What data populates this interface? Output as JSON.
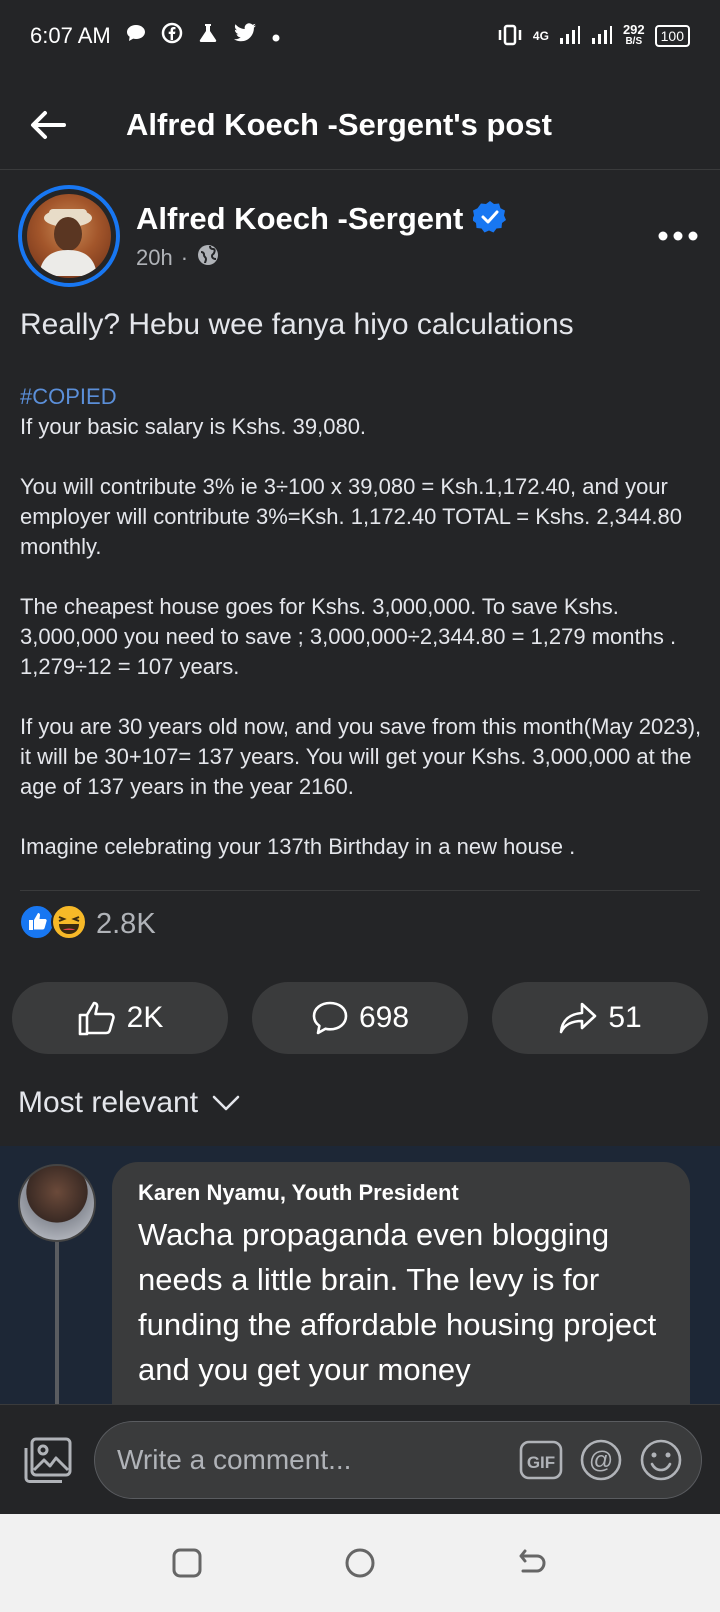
{
  "status_bar": {
    "time": "6:07 AM",
    "network": "4G",
    "speed_value": "292",
    "speed_unit": "B/S",
    "battery": "100"
  },
  "header": {
    "title": "Alfred Koech -Sergent's post"
  },
  "post": {
    "author": "Alfred Koech -Sergent",
    "time": "20h",
    "headline": "Really? Hebu wee fanya hiyo calculations",
    "hashtag": "#COPIED",
    "body": "If your basic salary is Kshs. 39,080.\n\nYou will contribute 3% ie 3÷100 x 39,080 = Ksh.1,172.40, and your employer will contribute 3%=Ksh. 1,172.40 TOTAL = Kshs. 2,344.80 monthly.\n\nThe cheapest house goes for Kshs. 3,000,000. To save Kshs. 3,000,000 you need to save ; 3,000,000÷2,344.80 = 1,279 months . 1,279÷12 = 107 years.\n\nIf you are 30 years old now, and you save from this month(May 2023), it will be 30+107= 137 years. You will get your Kshs. 3,000,000 at the age of 137 years in the year 2160.\n\nImagine celebrating your 137th Birthday in a new house ."
  },
  "reactions": {
    "total": "2.8K",
    "icons": [
      "like-icon",
      "haha-icon"
    ]
  },
  "actions": {
    "like": "2K",
    "comment": "698",
    "share": "51"
  },
  "sort": {
    "label": "Most relevant"
  },
  "comment": {
    "author": "Karen Nyamu, Youth President",
    "text": "Wacha propaganda even blogging needs a little brain. The levy is for funding the affordable housing project and you get your money"
  },
  "composer": {
    "placeholder": "Write a comment..."
  },
  "colors": {
    "accent": "#1877f2",
    "background": "#242527",
    "comment_bg": "#1d2736"
  }
}
